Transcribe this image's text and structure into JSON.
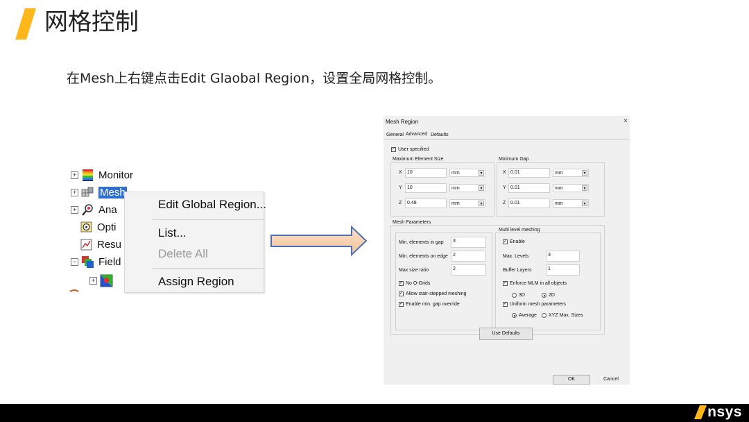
{
  "slide": {
    "title": "网格控制",
    "instruction": "在Mesh上右键点击Edit Glaobal Region，设置全局网格控制。",
    "accent_color": "#ffb71b",
    "logo_text": "nsys"
  },
  "tree": {
    "items": [
      {
        "label": "Monitor",
        "expander": "+",
        "icon": "monitor-icon"
      },
      {
        "label": "Mesh",
        "expander": "+",
        "icon": "mesh-icon",
        "selected": true
      },
      {
        "label": "Ana",
        "expander": "+",
        "icon": "analysis-icon"
      },
      {
        "label": "Opti",
        "expander": "",
        "icon": "optimetrics-icon"
      },
      {
        "label": "Resu",
        "expander": "",
        "icon": "results-icon"
      },
      {
        "label": "Field",
        "expander": "−",
        "icon": "field-overlays-icon"
      },
      {
        "label": "",
        "expander": "+",
        "icon": "field-plot-icon"
      }
    ]
  },
  "context_menu": {
    "edit_global_region": "Edit Global Region...",
    "list": "List...",
    "delete_all": "Delete All",
    "assign_region": "Assign Region"
  },
  "dialog": {
    "title": "Mesh Region",
    "close": "×",
    "tabs": {
      "general": "General",
      "advanced": "Advanced",
      "defaults": "Defaults"
    },
    "user_specified": {
      "label": "User specified",
      "checked": true
    },
    "max_element_size": {
      "label": "Maximum Element Size",
      "x": {
        "axis": "X",
        "value": "10",
        "unit": "mm"
      },
      "y": {
        "axis": "Y",
        "value": "10",
        "unit": "mm"
      },
      "z": {
        "axis": "Z",
        "value": "0.48",
        "unit": "mm"
      }
    },
    "minimum_gap": {
      "label": "Minimum Gap",
      "x": {
        "axis": "X",
        "value": "0.01",
        "unit": "mm"
      },
      "y": {
        "axis": "Y",
        "value": "0.01",
        "unit": "mm"
      },
      "z": {
        "axis": "Z",
        "value": "0.01",
        "unit": "mm"
      }
    },
    "mesh_parameters": {
      "label": "Mesh Parameters",
      "min_elements_in_gap": {
        "label": "Min. elements in gap",
        "value": "3"
      },
      "min_elements_on_edge": {
        "label": "Min. elements on edge",
        "value": "2"
      },
      "max_size_ratio": {
        "label": "Max size ratio",
        "value": "2"
      },
      "no_o_grids": {
        "label": "No O-Grids",
        "checked": true
      },
      "allow_stair_stepped": {
        "label": "Allow stair-stepped meshing",
        "checked": true
      },
      "enable_min_gap_override": {
        "label": "Enable min. gap override",
        "checked": true
      }
    },
    "multi_level": {
      "label": "Multi level meshing",
      "enable": {
        "label": "Enable",
        "checked": true
      },
      "max_levels": {
        "label": "Max. Levels",
        "value": "3"
      },
      "buffer_layers": {
        "label": "Buffer Layers",
        "value": "1"
      },
      "enforce_mlm": {
        "label": "Enforce MLM in all objects",
        "checked": true
      },
      "radio_3d": {
        "label": "3D",
        "selected": false
      },
      "radio_2d": {
        "label": "2D",
        "selected": true
      },
      "uniform_mesh": {
        "label": "Uniform mesh parameters",
        "checked": true
      },
      "radio_average": {
        "label": "Average",
        "selected": true
      },
      "radio_xyz_max": {
        "label": "XYZ Max. Sizes",
        "selected": false
      }
    },
    "use_defaults": "Use Defaults",
    "ok": "OK",
    "cancel": "Cancel"
  }
}
